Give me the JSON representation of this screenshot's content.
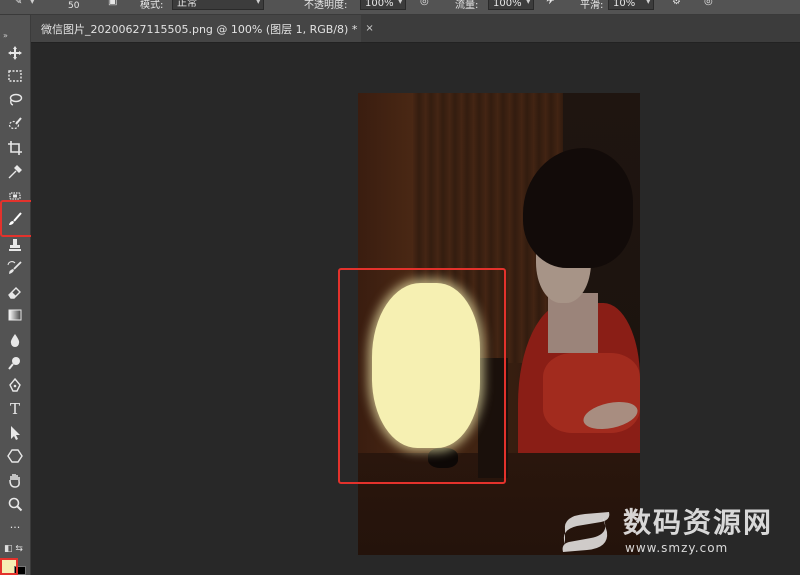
{
  "options_bar": {
    "brush_size": "50",
    "mode_label": "模式:",
    "mode_value": "正常",
    "opacity_label": "不透明度:",
    "opacity_value": "100%",
    "flow_label": "流量:",
    "flow_value": "100%",
    "smoothing_label": "平滑:",
    "smoothing_value": "10%"
  },
  "document_tab": {
    "title": "微信图片_20200627115505.png @ 100% (图层 1, RGB/8) *",
    "close": "×"
  },
  "toolbar": {
    "tools": [
      "move-tool",
      "marquee-tool",
      "lasso-tool",
      "quick-select-tool",
      "crop-tool",
      "eyedropper-tool",
      "healing-tool",
      "brush-tool",
      "clone-stamp-tool",
      "history-brush-tool",
      "eraser-tool",
      "gradient-tool",
      "blur-tool",
      "dodge-tool",
      "pen-tool",
      "type-tool",
      "path-select-tool",
      "shape-tool",
      "hand-tool",
      "zoom-tool",
      "more-tools"
    ],
    "type_tool_glyph": "T",
    "more_glyph": "···"
  },
  "colors": {
    "foreground": "#f6eeb4",
    "background": "#000000",
    "highlight": "#e3322c"
  },
  "watermark": {
    "text": "数码资源网",
    "url": "www.smzy.com"
  }
}
